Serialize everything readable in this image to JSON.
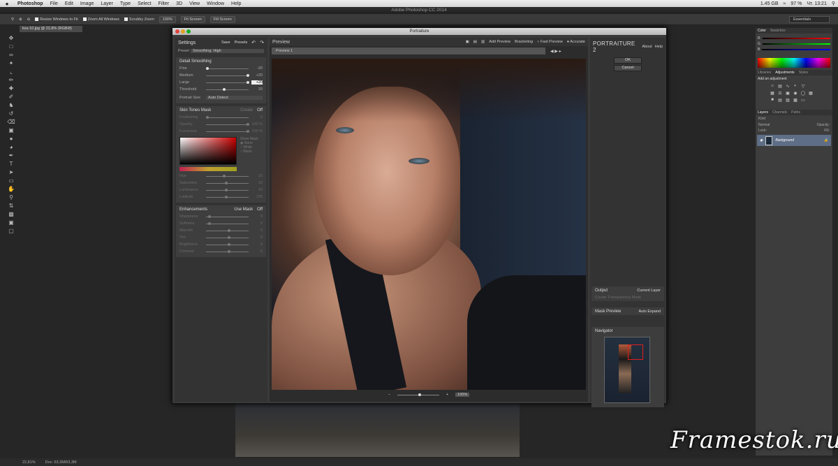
{
  "menubar": {
    "apple": "",
    "app": "Photoshop",
    "items": [
      "File",
      "Edit",
      "Image",
      "Layer",
      "Type",
      "Select",
      "Filter",
      "3D",
      "View",
      "Window",
      "Help"
    ],
    "status": {
      "disk": "1.45 GB",
      "battery": "97 %",
      "clock": "Чт. 13:21"
    }
  },
  "window_title": "Adobe Photoshop CC 2014",
  "options": {
    "resize": "Resize Windows to Fit",
    "zoom_all": "Zoom All Windows",
    "scrubby": "Scrubby Zoom",
    "zoom_pct": "100%",
    "fit": "Fit Screen",
    "fill": "Fill Screen",
    "workspace": "Essentials"
  },
  "doc_tab": "liza-10.jpg @ 22,8% (RGB/8)",
  "status": {
    "zoom": "22,81%",
    "doc": "Doc: 63,3M/63,3M"
  },
  "plugin": {
    "title": "Portraiture",
    "settings": {
      "title": "Settings",
      "save": "Save",
      "presets": "Presets",
      "preset_label": "Preset",
      "preset_value": "Smoothing: High",
      "detail": {
        "title": "Detail Smoothing",
        "rows": [
          {
            "label": "Fine",
            "value": "-20"
          },
          {
            "label": "Medium",
            "value": "+20"
          },
          {
            "label": "Large",
            "value": "+20"
          },
          {
            "label": "Threshold",
            "value": "20"
          }
        ],
        "portrait_label": "Portrait Size",
        "portrait_value": "Auto Detect"
      },
      "skin": {
        "title": "Skin Tones Mask",
        "mode": "Create",
        "off": "Off",
        "rows": [
          {
            "label": "Feathering",
            "value": "0"
          },
          {
            "label": "Opacity",
            "value": "100 %"
          },
          {
            "label": "Fuzziness",
            "value": "100 %"
          }
        ],
        "mask_title": "Show Mask",
        "opts": [
          "None",
          "White",
          "Black"
        ],
        "rows2": [
          {
            "label": "Hue",
            "value": "10"
          },
          {
            "label": "Saturation",
            "value": "10"
          },
          {
            "label": "Luminance",
            "value": "10"
          },
          {
            "label": "Latitude",
            "value": "100"
          }
        ]
      },
      "enh": {
        "title": "Enhancements",
        "use_mask": "Use Mask",
        "off": "Off",
        "rows": [
          {
            "label": "Sharpness",
            "value": "0"
          },
          {
            "label": "Softness",
            "value": "0"
          },
          {
            "label": "Warmth",
            "value": "0"
          },
          {
            "label": "Tint",
            "value": "0"
          },
          {
            "label": "Brightness",
            "value": "0"
          },
          {
            "label": "Contrast",
            "value": "0"
          }
        ]
      }
    },
    "preview": {
      "title": "Preview",
      "add": "Add Preview",
      "bracket": "Bracketing",
      "fast": "Fast Preview",
      "accurate": "Accurate",
      "tab": "Preview 1",
      "zoom": "100%"
    },
    "right": {
      "logo": "PORTRAITURE 2",
      "about": "About",
      "help": "Help",
      "ok": "OK",
      "cancel": "Cancel",
      "output_label": "Output",
      "output_value": "Current Layer",
      "transparency": "Create Transparency Mask",
      "mask_preview": "Mask Preview",
      "auto_expand": "Auto Expand",
      "navigator": "Navigator"
    }
  },
  "panels": {
    "color_tabs": [
      "Color",
      "Swatches"
    ],
    "r": "R",
    "g": "G",
    "b": "B",
    "adj_tabs": [
      "Libraries",
      "Adjustments",
      "Styles"
    ],
    "adj_title": "Add an adjustment",
    "layer_tabs": [
      "Layers",
      "Channels",
      "Paths"
    ],
    "kind": "Kind",
    "normal": "Normal",
    "opacity": "Opacity:",
    "lock": "Lock:",
    "fill": "Fill:",
    "layer": "Background"
  },
  "watermark": "Framestok.ru"
}
